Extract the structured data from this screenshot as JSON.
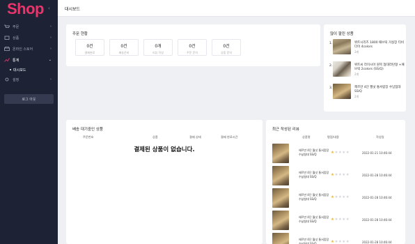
{
  "brand": {
    "logo": "Shop"
  },
  "sidebar": {
    "items": [
      {
        "label": "주문",
        "active": false
      },
      {
        "label": "상품",
        "active": false
      },
      {
        "label": "온라인 스토어",
        "active": false
      },
      {
        "label": "통계",
        "active": true
      },
      {
        "label": "설정",
        "active": false
      }
    ],
    "sub_items": [
      {
        "label": "대시보드"
      }
    ],
    "logout": "로그 아웃"
  },
  "header": {
    "title": "대시보드"
  },
  "order_status": {
    "title": "주문 현황",
    "stats": [
      {
        "value": "0건",
        "label": "결제완료"
      },
      {
        "value": "0건",
        "label": "배송준비"
      },
      {
        "value": "0개",
        "label": "리뷰 작성"
      },
      {
        "value": "0건",
        "label": "주문 문의"
      },
      {
        "value": "0건",
        "label": "상품 문의"
      }
    ]
  },
  "popular": {
    "title": "많이 팔린 상품",
    "items": [
      {
        "no": "1.",
        "name": "위트시리즈 1800 패브릭 거실장 티비다이 4colors",
        "count": "3개",
        "thumb": "photo-a"
      },
      {
        "no": "2.",
        "name": "위트씨 라이시아 원목 협대라탄형 +패브릭 2colors (SS/Q)",
        "count": "2개",
        "thumb": "photo-b"
      },
      {
        "no": "3.",
        "name": "헤르만 4단 월넛 통서랍장 수납침대 SS/Q",
        "count": "2개",
        "thumb": "photo-c"
      }
    ]
  },
  "shipping": {
    "title": "배송 대기중인 상품",
    "columns": [
      "주문번호",
      "상품",
      "결제 상태",
      "결제 완료시간"
    ],
    "empty_message": "결제된 상품이 없습니다."
  },
  "reviews": {
    "title": "최근 작성된 리뷰",
    "columns": [
      "상품명",
      "평점/내용",
      "작성일"
    ],
    "items": [
      {
        "name": "헤르만 4단 월넛 통서랍장 수납침대 SS/Q",
        "rating": 1,
        "date": "2022-01-21 10:46:44"
      },
      {
        "name": "헤르만 4단 월넛 통서랍장 수납침대 SS/Q",
        "rating": 1,
        "date": "2022-01-28 10:46:44"
      },
      {
        "name": "헤르만 4단 월넛 통서랍장 수납침대 SS/Q",
        "rating": 1,
        "date": "2022-01-28 10:46:44"
      },
      {
        "name": "헤르만 4단 월넛 통서랍장 수납침대 SS/Q",
        "rating": 1,
        "date": "2022-01-28 10:46:44"
      },
      {
        "name": "헤르만 4단 월넛 통서랍장 수납침대 SS/Q",
        "rating": 1,
        "date": "2022-01-28 10:46:44"
      }
    ]
  },
  "colors": {
    "brand": "#e8356b",
    "sidebar": "#1e2235",
    "star": "#f5b81c"
  }
}
